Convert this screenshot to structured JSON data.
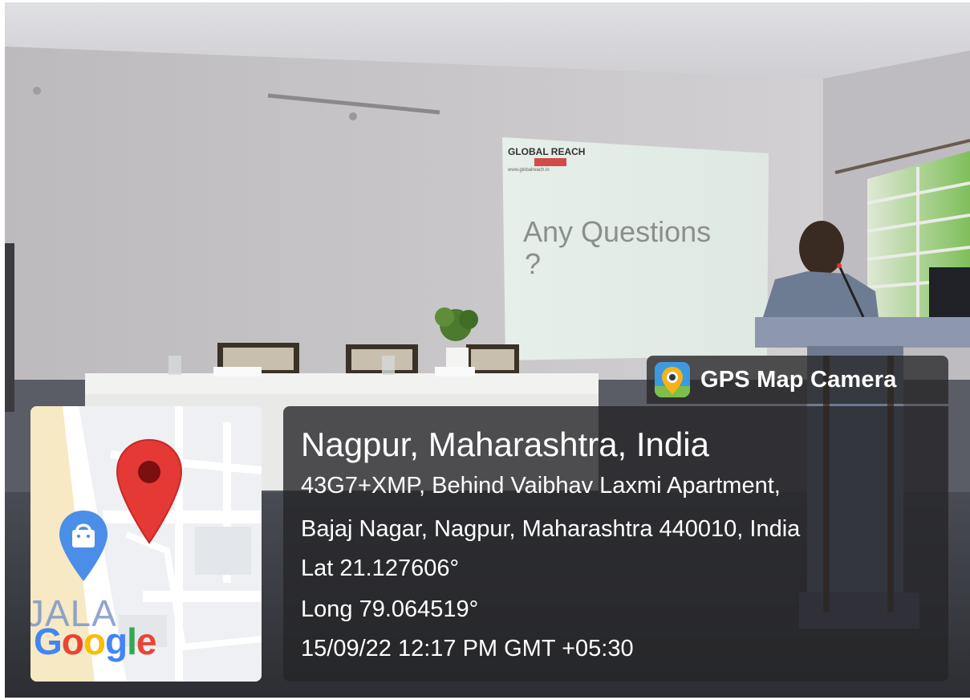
{
  "photo": {
    "projector_logo": "GLOBAL REACH",
    "projector_url": "www.globalreach.in",
    "slide_line_1": "Any Questions",
    "slide_line_2": "?"
  },
  "map": {
    "street_label": "JALA",
    "google_logo": [
      "G",
      "o",
      "o",
      "g",
      "l",
      "e"
    ],
    "pin_icon": "location-pin-icon",
    "shop_icon": "shopping-bag-icon"
  },
  "app": {
    "name": "GPS Map Camera",
    "icon": "gps-camera-icon"
  },
  "location": {
    "title": "Nagpur, Maharashtra, India",
    "address_line_1": "43G7+XMP, Behind Vaibhav Laxmi Apartment,",
    "address_line_2": "Bajaj Nagar, Nagpur, Maharashtra 440010, India",
    "latitude": "Lat 21.127606°",
    "longitude": "Long 79.064519°",
    "timestamp": "15/09/22 12:17 PM GMT +05:30"
  },
  "colors": {
    "pin_red": "#e53935",
    "shop_blue": "#4a8ee8",
    "panel_bg": "#262628"
  }
}
